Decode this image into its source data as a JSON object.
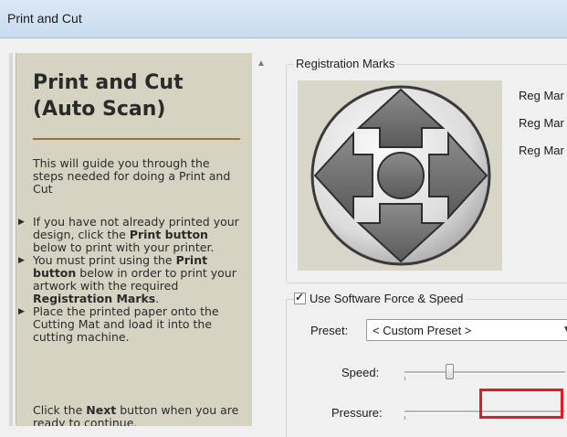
{
  "window": {
    "title": "Print and Cut"
  },
  "guide": {
    "heading": "Print and Cut (Auto Scan)",
    "intro": "This will guide you through the steps needed for doing a Print and Cut",
    "bullet1_a": "If you have not already printed your design, click the ",
    "bullet1_b": "Print button",
    "bullet1_c": " below to print with your printer.",
    "bullet2_a": "You must print using the ",
    "bullet2_b": "Print button",
    "bullet2_c": " below in order to print your artwork with the required ",
    "bullet2_d": "Registration Marks",
    "bullet2_e": ".",
    "bullet3": "Place the printed paper onto the Cutting Mat and load it into the cutting machine.",
    "outro_a": "Click the ",
    "outro_b": "Next",
    "outro_c": " button when you are ready to continue."
  },
  "registration": {
    "legend": "Registration Marks",
    "labels": [
      "Reg Mar",
      "Reg Mar",
      "Reg Mar"
    ]
  },
  "force": {
    "checkbox_label": "Use Software Force  & Speed",
    "checked": true,
    "preset_label": "Preset:",
    "preset_value": "< Custom Preset >",
    "speed_label": "Speed:",
    "pressure_label": "Pressure:"
  },
  "colors": {
    "highlight": "#e51c1c",
    "guide_bg": "#d6d3c3",
    "rule": "#a4712b"
  }
}
